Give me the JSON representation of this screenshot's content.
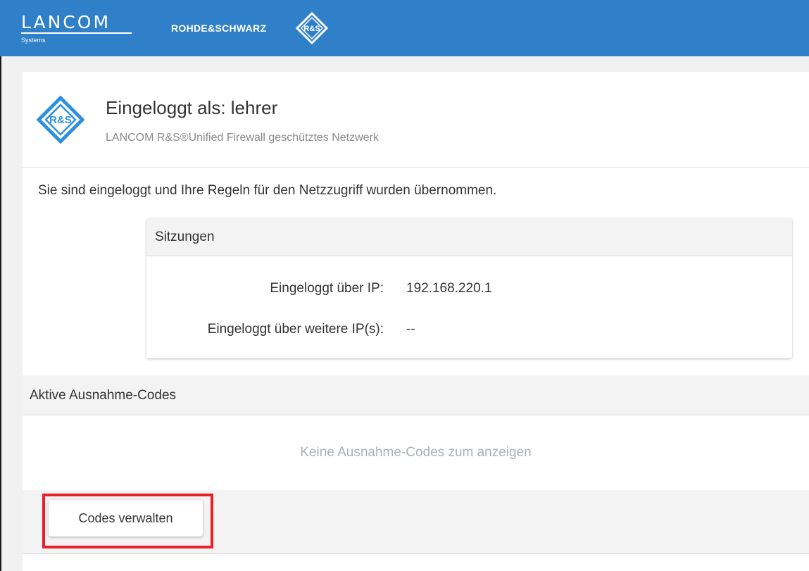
{
  "topbar": {
    "brand_name": "LANCOM",
    "brand_sub": "Systems",
    "partner_name": "ROHDE&SCHWARZ",
    "partner_logo_text": "R&S",
    "background": "#2f80c8"
  },
  "card": {
    "icon": "rs-diamond-icon",
    "icon_color": "#2f8fdd",
    "title": "Eingeloggt als: lehrer",
    "subtitle": "LANCOM R&S®Unified Firewall geschütztes Netzwerk"
  },
  "status_text": "Sie sind eingeloggt und Ihre Regeln für den Netzzugriff wurden übernommen.",
  "sessions": {
    "title": "Sitzungen",
    "rows": [
      {
        "label": "Eingeloggt über IP:",
        "value": "192.168.220.1"
      },
      {
        "label": "Eingeloggt über weitere IP(s):",
        "value": "--"
      }
    ]
  },
  "exception_codes": {
    "title": "Aktive Ausnahme-Codes",
    "empty_message": "Keine Ausnahme-Codes zum anzeigen",
    "manage_button_label": "Codes verwalten",
    "highlight_color": "#e8202a"
  }
}
